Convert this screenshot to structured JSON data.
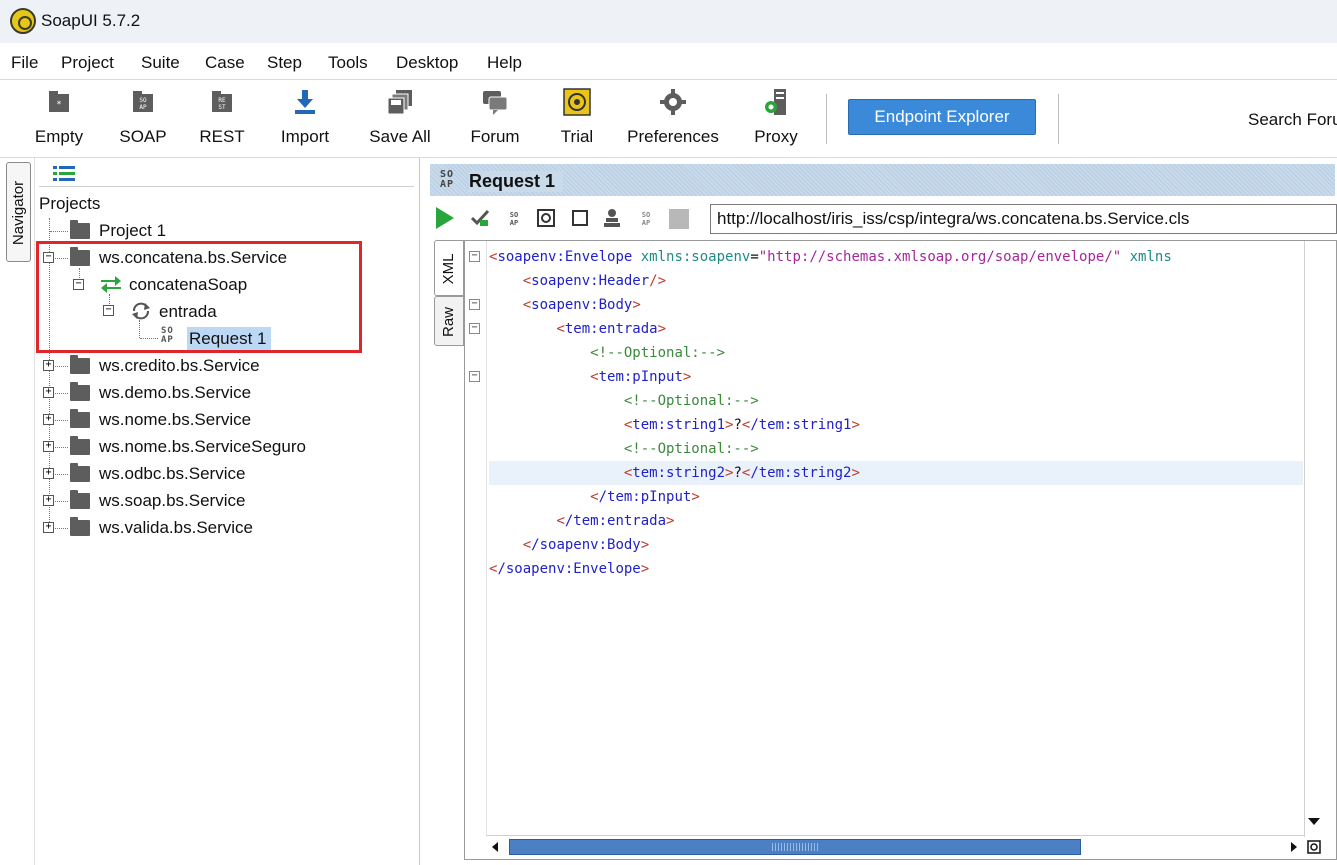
{
  "window": {
    "title": "SoapUI 5.7.2"
  },
  "menu": [
    "File",
    "Project",
    "Suite",
    "Case",
    "Step",
    "Tools",
    "Desktop",
    "Help"
  ],
  "toolbar": {
    "buttons": [
      "Empty",
      "SOAP",
      "REST",
      "Import",
      "Save All",
      "Forum",
      "Trial",
      "Preferences",
      "Proxy"
    ],
    "endpoint_explorer": "Endpoint Explorer",
    "search_forum": "Search Foru"
  },
  "navigator": {
    "tab_label": "Navigator",
    "root": "Projects",
    "projects": [
      "Project 1",
      "ws.concatena.bs.Service",
      "ws.credito.bs.Service",
      "ws.demo.bs.Service",
      "ws.nome.bs.Service",
      "ws.nome.bs.ServiceSeguro",
      "ws.odbc.bs.Service",
      "ws.soap.bs.Service",
      "ws.valida.bs.Service"
    ],
    "interface": "concatenaSoap",
    "operation": "entrada",
    "request": "Request 1",
    "soap_glyph_top": "SO",
    "soap_glyph_bottom": "AP",
    "highlight_color": "#e0262b"
  },
  "request_editor": {
    "title": "Request 1",
    "soap_glyph_top": "SO",
    "soap_glyph_bottom": "AP",
    "url": "http://localhost/iris_iss/csp/integra/ws.concatena.bs.Service.cls",
    "side_tabs": [
      "XML",
      "Raw"
    ],
    "xml": {
      "envelope_tag": "soapenv:Envelope",
      "ns_attr": "xmlns:soapenv",
      "ns_value": "\"http://schemas.xmlsoap.org/soap/envelope/\"",
      "ns_attr_2": "xmlns",
      "header_tag": "soapenv:Header",
      "body_tag": "soapenv:Body",
      "op_tag": "tem:entrada",
      "comment": "<!--Optional:-->",
      "input_tag": "tem:pInput",
      "string1_tag": "tem:string1",
      "string2_tag": "tem:string2",
      "placeholder": "?",
      "close_body": "/soapenv:Body",
      "close_envelope": "/soapenv:Envelope",
      "close_op": "/tem:entrada",
      "close_input": "/tem:pInput",
      "close_string1": "/tem:string1",
      "close_string2": "/tem:string2"
    }
  },
  "colors": {
    "accent": "#3b8ad9",
    "selection": "#bcd8f4",
    "play": "#2aa53b"
  }
}
